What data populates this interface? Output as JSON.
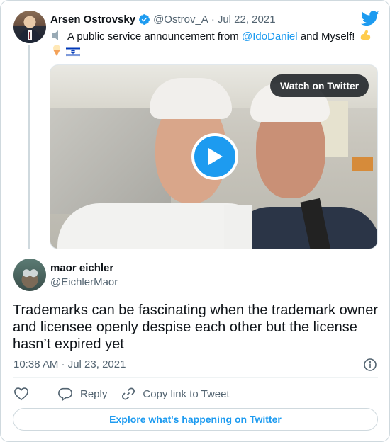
{
  "quoted_tweet": {
    "author_name": "Arsen Ostrovsky",
    "handle": "@Ostrov_A",
    "separator": "·",
    "date": "Jul 22, 2021",
    "text_before": "A public service announcement from ",
    "mention": "@IdoDaniel",
    "text_after": " and Myself! ",
    "media": {
      "watch_label": "Watch on Twitter"
    }
  },
  "tweet": {
    "author_name": "maor eichler",
    "handle": "@EichlerMaor",
    "text": "Trademarks can be fascinating when the trademark owner and licensee openly despise each other but the license hasn’t expired yet",
    "timestamp": "10:38 AM · Jul 23, 2021"
  },
  "actions": {
    "reply_label": "Reply",
    "copy_link_label": "Copy link to Tweet"
  },
  "explore_label": "Explore what's happening on Twitter",
  "colors": {
    "accent": "#1d9bf0",
    "text": "#0f1419",
    "muted": "#536471",
    "border": "#cfd9de"
  },
  "icons": [
    "twitter-bird-icon",
    "verified-badge-icon",
    "speaker-icon",
    "flexed-biceps-icon",
    "ice-cream-icon",
    "israel-flag-icon",
    "play-icon",
    "info-icon",
    "heart-icon",
    "reply-icon",
    "link-icon"
  ]
}
